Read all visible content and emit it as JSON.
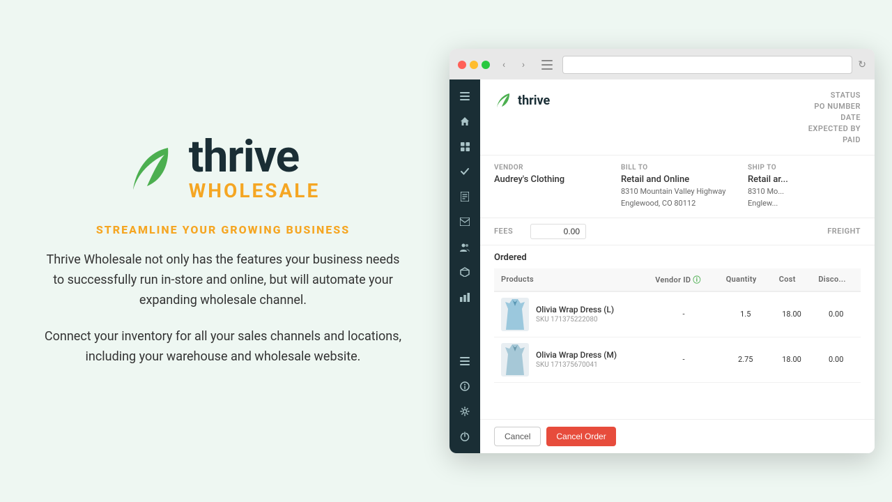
{
  "background_color": "#eef7f2",
  "left": {
    "logo": {
      "thrive": "thrive",
      "wholesale": "WHOLESALE"
    },
    "tagline": "STREAMLINE YOUR GROWING BUSINESS",
    "paragraph1": "Thrive Wholesale not only has the features your business needs to successfully run in-store and online, but will automate your expanding wholesale channel.",
    "paragraph2": "Connect your inventory for all your sales channels and locations, including your warehouse and wholesale website."
  },
  "browser": {
    "address_bar_placeholder": ""
  },
  "app": {
    "logo": "thrive",
    "order": {
      "status_label": "STATUS",
      "po_number_label": "PO NUMBER",
      "date_label": "DATE",
      "expected_by_label": "EXPECTED BY",
      "paid_label": "PAID"
    },
    "vendor": {
      "vendor_label": "VENDOR",
      "vendor_name": "Audrey's Clothing",
      "bill_to_label": "BILL TO",
      "bill_to_name": "Retail and Online",
      "bill_to_address1": "8310 Mountain Valley Highway",
      "bill_to_address2": "Englewood, CO 80112",
      "ship_to_label": "SHIP TO",
      "ship_to_name": "Retail ar...",
      "ship_to_address1": "8310 Mo...",
      "ship_to_address2": "Englew..."
    },
    "fees": {
      "fees_label": "FEES",
      "fees_value": "0.00",
      "freight_label": "FREIGHT"
    },
    "ordered_section": {
      "title": "Ordered",
      "columns": [
        "Products",
        "Vendor ID",
        "Quantity",
        "Cost",
        "Disco..."
      ],
      "rows": [
        {
          "name": "Olivia Wrap Dress (L)",
          "sku": "SKU 171375222080",
          "vendor_id": "-",
          "quantity": "1.5",
          "cost": "18.00",
          "discount": "0.00"
        },
        {
          "name": "Olivia Wrap Dress (M)",
          "sku": "SKU 171375670041",
          "vendor_id": "-",
          "quantity": "2.75",
          "cost": "18.00",
          "discount": "0.00"
        }
      ]
    },
    "footer": {
      "cancel_label": "Cancel",
      "cancel_order_label": "Cancel Order"
    },
    "sidebar_icons": [
      "☰",
      "⌂",
      "⊞",
      "✓",
      "▤",
      "✉",
      "♟",
      "▣",
      "📊",
      "☰",
      "ℹ",
      "⚙",
      "⏻"
    ]
  }
}
